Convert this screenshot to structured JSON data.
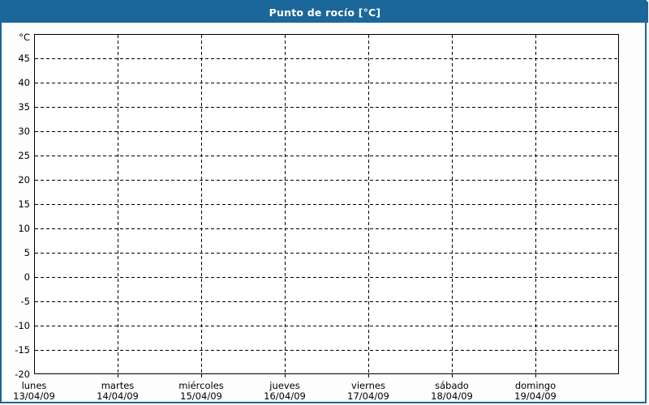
{
  "header": {
    "title": "Punto de rocío [°C]"
  },
  "colors": {
    "accent_blue": "#1b679a",
    "header_text": "#ffffff",
    "page_background": "#fcfdfc",
    "plot_background": "#ffffff",
    "grid_line": "#000000",
    "axis_line": "#000000"
  },
  "chart_data": {
    "type": "line",
    "title": "Punto de rocío [°C]",
    "ylabel": "°C",
    "xlabel": "",
    "ylim": [
      -20,
      50
    ],
    "y_tick_interval": 5,
    "y_tick_labels": [
      45,
      40,
      35,
      30,
      25,
      20,
      15,
      10,
      5,
      0,
      -5,
      -10,
      -15,
      -20
    ],
    "x_categories": [
      {
        "day": "lunes",
        "date": "13/04/09"
      },
      {
        "day": "martes",
        "date": "14/04/09"
      },
      {
        "day": "miércoles",
        "date": "15/04/09"
      },
      {
        "day": "jueves",
        "date": "16/04/09"
      },
      {
        "day": "viernes",
        "date": "17/04/09"
      },
      {
        "day": "sábado",
        "date": "18/04/09"
      },
      {
        "day": "domingo",
        "date": "19/04/09"
      }
    ],
    "series": [],
    "grid": {
      "horizontal": "dashed",
      "vertical": "dashed"
    },
    "legend_position": "none"
  }
}
